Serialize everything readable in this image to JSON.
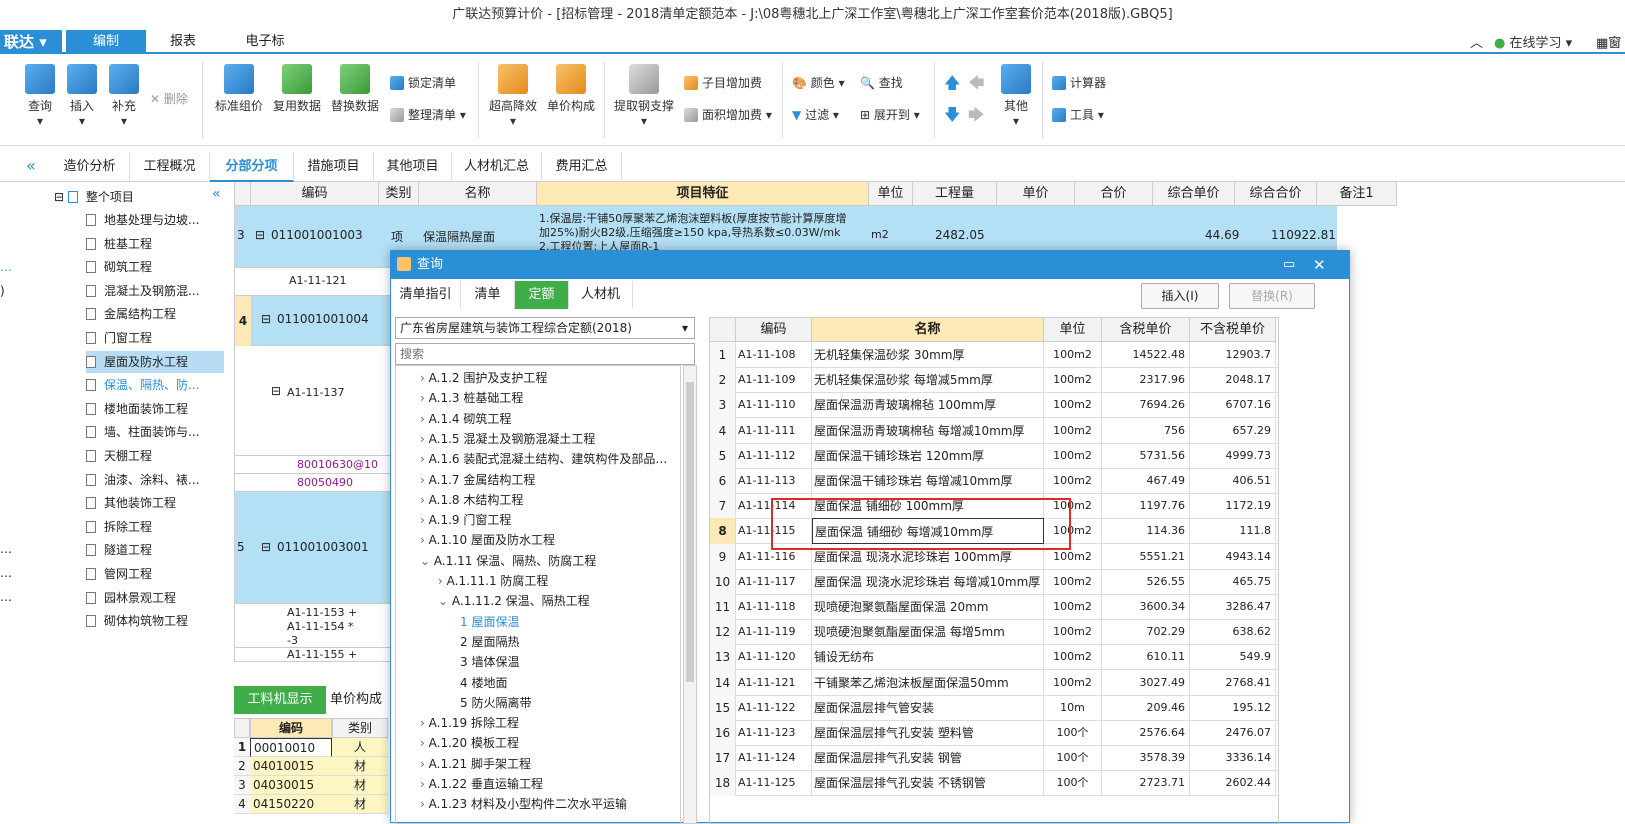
{
  "window": {
    "title": "广联达预算计价 - [招标管理 - 2018清单定额范本 - J:\\08粤穗北上广深工作室\\粤穗北上广深工作室套价范本(2018版).GBQ5]"
  },
  "menubar": {
    "app_label": "联达",
    "tabs": [
      "编制",
      "报表",
      "电子标"
    ],
    "right": {
      "online_learn": "在线学习",
      "window_label": "窗"
    }
  },
  "ribbon": {
    "query": "查询",
    "insert": "插入",
    "supplement": "补充",
    "delete": "删除",
    "standard_group": "标准组价",
    "reuse_data": "复用数据",
    "replace_data": "替换数据",
    "lock_list": "锁定清单",
    "arrange_list": "整理清单",
    "super_height": "超高降效",
    "unit_price_comp": "单价构成",
    "extract_steel": "提取钢支撑",
    "sub_add_fee": "子目增加费",
    "area_add_fee": "面积增加费",
    "color": "颜色",
    "find": "查找",
    "filter": "过滤",
    "expand_to": "展开到",
    "other": "其他",
    "calculator": "计算器",
    "tools": "工具"
  },
  "pagetabs": [
    "造价分析",
    "工程概况",
    "分部分项",
    "措施项目",
    "其他项目",
    "人材机汇总",
    "费用汇总"
  ],
  "tree": {
    "root": "整个项目",
    "items": [
      "地基处理与边坡...",
      "桩基工程",
      "砌筑工程",
      "混凝土及钢筋混...",
      "金属结构工程",
      "门窗工程",
      "屋面及防水工程",
      "保温、隔热、防...",
      "楼地面装饰工程",
      "墙、柱面装饰与...",
      "天棚工程",
      "油漆、涂料、裱...",
      "其他装饰工程",
      "拆除工程",
      "隧道工程",
      "管网工程",
      "园林景观工程",
      "砌体构筑物工程"
    ]
  },
  "grid": {
    "headers": [
      "编码",
      "类别",
      "名称",
      "项目特征",
      "单位",
      "工程量",
      "单价",
      "合价",
      "综合单价",
      "综合合价",
      "备注1"
    ],
    "row3": {
      "no": "3",
      "code": "011001001003",
      "type": "项",
      "name": "保温隔热屋面",
      "feature1": "1.保温层:干铺50厚聚苯乙烯泡沫塑料板(厚度按节能计算厚度增",
      "feature2": "加25%)耐火B2级,压缩强度≥150 kpa,导热系数≤0.03W/mk",
      "feature3": "2.工程位置:上人屋面R-1",
      "unit": "m2",
      "qty": "2482.05",
      "comp_price": "44.69",
      "comp_total": "110922.81"
    },
    "row_a121": "A1-11-121",
    "row4": {
      "no": "4",
      "code": "011001001004"
    },
    "row_a137": "A1-11-137",
    "row_m1": "80010630@10",
    "row_m2": "80050490",
    "row5": {
      "no": "5",
      "code": "011001003001"
    },
    "row_a153": "A1-11-153 +",
    "row_a154": "A1-11-154 *",
    "row_a154b": "-3",
    "row_a155": "A1-11-155 +"
  },
  "bottom": {
    "tab1": "工料机显示",
    "tab2": "单价构成",
    "headers": [
      "编码",
      "类别"
    ],
    "rows": [
      {
        "no": "1",
        "code": "00010010",
        "type": "人"
      },
      {
        "no": "2",
        "code": "04010015",
        "type": "材"
      },
      {
        "no": "3",
        "code": "04030015",
        "type": "材"
      },
      {
        "no": "4",
        "code": "04150220",
        "type": "材"
      }
    ]
  },
  "dialog": {
    "title": "查询",
    "tabs": [
      "清单指引",
      "清单",
      "定额",
      "人材机"
    ],
    "insert_btn": "插入(I)",
    "replace_btn": "替换(R)",
    "library": "广东省房屋建筑与装饰工程综合定额(2018)",
    "search_placeholder": "搜索",
    "tree": [
      "A.1.2 围护及支护工程",
      "A.1.3 桩基础工程",
      "A.1.4 砌筑工程",
      "A.1.5 混凝土及钢筋混凝土工程",
      "A.1.6 装配式混凝土结构、建筑构件及部品…",
      "A.1.7 金属结构工程",
      "A.1.8 木结构工程",
      "A.1.9 门窗工程",
      "A.1.10 屋面及防水工程",
      "A.1.11 保温、隔热、防腐工程",
      "A.1.11.1 防腐工程",
      "A.1.11.2 保温、隔热工程",
      "1 屋面保温",
      "2 屋面隔热",
      "3 墙体保温",
      "4 楼地面",
      "5 防火隔离带",
      "A.1.19 拆除工程",
      "A.1.20 模板工程",
      "A.1.21 脚手架工程",
      "A.1.22 垂直运输工程",
      "A.1.23 材料及小型构件二次水平运输"
    ],
    "table_headers": [
      "编码",
      "名称",
      "单位",
      "含税单价",
      "不含税单价"
    ],
    "rows": [
      {
        "no": "1",
        "code": "A1-11-108",
        "name": "无机轻集保温砂浆 30mm厚",
        "unit": "100m2",
        "tax": "14522.48",
        "notax": "12903.7"
      },
      {
        "no": "2",
        "code": "A1-11-109",
        "name": "无机轻集保温砂浆 每增减5mm厚",
        "unit": "100m2",
        "tax": "2317.96",
        "notax": "2048.17"
      },
      {
        "no": "3",
        "code": "A1-11-110",
        "name": "屋面保温沥青玻璃棉毡 100mm厚",
        "unit": "100m2",
        "tax": "7694.26",
        "notax": "6707.16"
      },
      {
        "no": "4",
        "code": "A1-11-111",
        "name": "屋面保温沥青玻璃棉毡 每增减10mm厚",
        "unit": "100m2",
        "tax": "756",
        "notax": "657.29"
      },
      {
        "no": "5",
        "code": "A1-11-112",
        "name": "屋面保温干铺珍珠岩 120mm厚",
        "unit": "100m2",
        "tax": "5731.56",
        "notax": "4999.73"
      },
      {
        "no": "6",
        "code": "A1-11-113",
        "name": "屋面保温干铺珍珠岩 每增减10mm厚",
        "unit": "100m2",
        "tax": "467.49",
        "notax": "406.51"
      },
      {
        "no": "7",
        "code": "A1-11-114",
        "name": "屋面保温 铺细砂 100mm厚",
        "unit": "100m2",
        "tax": "1197.76",
        "notax": "1172.19"
      },
      {
        "no": "8",
        "code": "A1-11-115",
        "name": "屋面保温 铺细砂 每增减10mm厚",
        "unit": "100m2",
        "tax": "114.36",
        "notax": "111.8"
      },
      {
        "no": "9",
        "code": "A1-11-116",
        "name": "屋面保温 现浇水泥珍珠岩 100mm厚",
        "unit": "100m2",
        "tax": "5551.21",
        "notax": "4943.14"
      },
      {
        "no": "10",
        "code": "A1-11-117",
        "name": "屋面保温 现浇水泥珍珠岩 每增减10mm厚",
        "unit": "100m2",
        "tax": "526.55",
        "notax": "465.75"
      },
      {
        "no": "11",
        "code": "A1-11-118",
        "name": "现喷硬泡聚氨酯屋面保温 20mm",
        "unit": "100m2",
        "tax": "3600.34",
        "notax": "3286.47"
      },
      {
        "no": "12",
        "code": "A1-11-119",
        "name": "现喷硬泡聚氨酯屋面保温 每增5mm",
        "unit": "100m2",
        "tax": "702.29",
        "notax": "638.62"
      },
      {
        "no": "13",
        "code": "A1-11-120",
        "name": "铺设无纺布",
        "unit": "100m2",
        "tax": "610.11",
        "notax": "549.9"
      },
      {
        "no": "14",
        "code": "A1-11-121",
        "name": "干铺聚苯乙烯泡沫板屋面保温50mm",
        "unit": "100m2",
        "tax": "3027.49",
        "notax": "2768.41"
      },
      {
        "no": "15",
        "code": "A1-11-122",
        "name": "屋面保温层排气管安装",
        "unit": "10m",
        "tax": "209.46",
        "notax": "195.12"
      },
      {
        "no": "16",
        "code": "A1-11-123",
        "name": "屋面保温层排气孔安装 塑料管",
        "unit": "100个",
        "tax": "2576.64",
        "notax": "2476.07"
      },
      {
        "no": "17",
        "code": "A1-11-124",
        "name": "屋面保温层排气孔安装 钢管",
        "unit": "100个",
        "tax": "3578.39",
        "notax": "3336.14"
      },
      {
        "no": "18",
        "code": "A1-11-125",
        "name": "屋面保温层排气孔安装 不锈钢管",
        "unit": "100个",
        "tax": "2723.71",
        "notax": "2602.44"
      }
    ]
  },
  "colors": {
    "accent": "#2a8fd6",
    "green": "#3fae49",
    "highlight": "#e0292b"
  }
}
